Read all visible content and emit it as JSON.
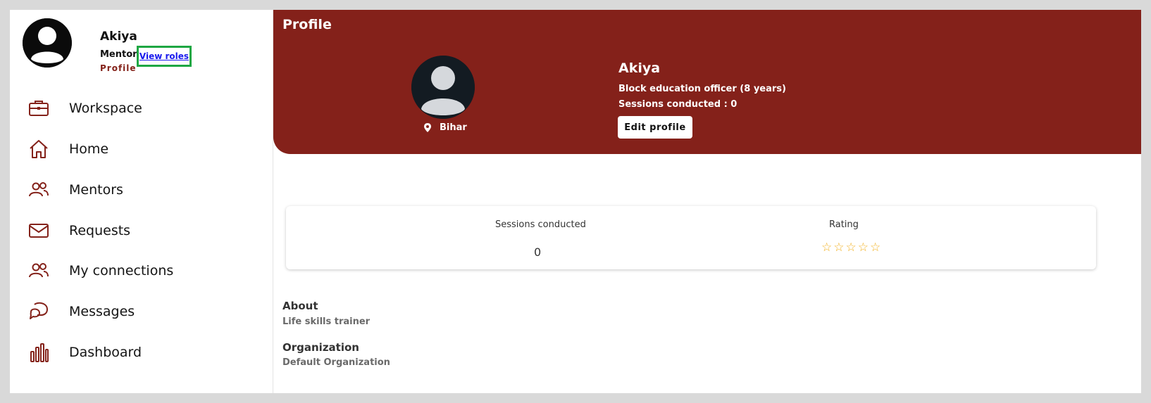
{
  "sidebar": {
    "user": {
      "name": "Akiya",
      "role": "Mentor",
      "view_roles_link": "View roles",
      "profile_link": "Profile"
    },
    "items": [
      {
        "label": "Workspace",
        "icon": "briefcase-icon"
      },
      {
        "label": "Home",
        "icon": "home-icon"
      },
      {
        "label": "Mentors",
        "icon": "people-icon"
      },
      {
        "label": "Requests",
        "icon": "mail-icon"
      },
      {
        "label": "My connections",
        "icon": "people-icon"
      },
      {
        "label": "Messages",
        "icon": "chat-bubbles-icon"
      },
      {
        "label": "Dashboard",
        "icon": "bar-chart-icon"
      }
    ]
  },
  "profile": {
    "page_title": "Profile",
    "name": "Akiya",
    "designation": "Block education officer (8 years)",
    "sessions_conducted_line": "Sessions conducted : 0",
    "location": "Bihar",
    "edit_button": "Edit profile"
  },
  "stats": {
    "sessions_label": "Sessions conducted",
    "sessions_value": "0",
    "rating_label": "Rating",
    "rating_stars_filled": 0,
    "rating_stars_total": 5
  },
  "about": {
    "title": "About",
    "text": "Life skills trainer"
  },
  "organization": {
    "title": "Organization",
    "text": "Default Organization"
  },
  "colors": {
    "brand": "#84211a",
    "highlight_border": "#1ea743",
    "link": "#1a1aee",
    "star": "#f2b01e"
  }
}
